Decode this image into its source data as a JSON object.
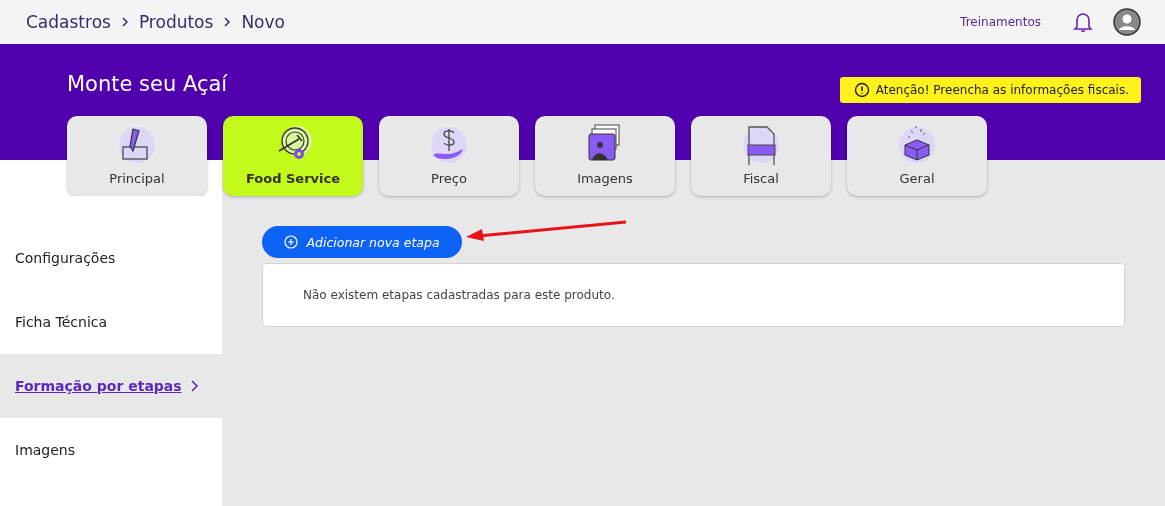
{
  "breadcrumbs": [
    "Cadastros",
    "Produtos",
    "Novo"
  ],
  "topbar": {
    "link": "Treinamentos"
  },
  "title": "Monte seu Açaí",
  "alert": {
    "text": "Atenção! Preencha as informações fiscais."
  },
  "tabs": [
    {
      "label": "Principal",
      "kind": "pencil",
      "selected": false
    },
    {
      "label": "Food Service",
      "kind": "plate",
      "selected": true
    },
    {
      "label": "Preço",
      "kind": "price",
      "selected": false
    },
    {
      "label": "Imagens",
      "kind": "images",
      "selected": false
    },
    {
      "label": "Fiscal",
      "kind": "invoice",
      "selected": false
    },
    {
      "label": "Geral",
      "kind": "box",
      "selected": false
    }
  ],
  "sidebar": {
    "items": [
      {
        "label": "Configurações",
        "selected": false
      },
      {
        "label": "Ficha Técnica",
        "selected": false
      },
      {
        "label": "Formação por etapas",
        "selected": true
      },
      {
        "label": "Imagens",
        "selected": false
      }
    ]
  },
  "add_button": "Adicionar nova etapa",
  "empty_message": "Não existem etapas cadastradas para este produto."
}
